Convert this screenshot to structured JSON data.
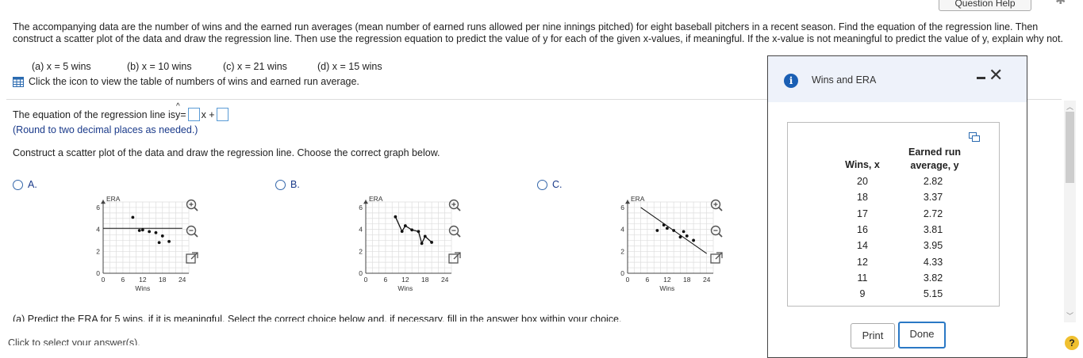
{
  "header": {
    "help_button_label": "Question Help",
    "settings_icon": "gear-icon"
  },
  "problem": {
    "text": "The accompanying data are the number of wins and the earned run averages (mean number of earned runs allowed per nine innings pitched) for eight baseball pitchers in a recent season. Find the equation of the regression line. Then construct a scatter plot of the data and draw the regression line. Then use the regression equation to predict the value of y for each of the given x-values, if meaningful. If the x-value is not meaningful to predict the value of y, explain why not.",
    "parts": [
      "(a) x = 5 wins",
      "(b) x = 10 wins",
      "(c) x = 21 wins",
      "(d) x = 15 wins"
    ],
    "table_link": "Click the icon to view the table of numbers of wins and earned run average."
  },
  "regression": {
    "prefix": "The equation of the regression line is ",
    "yhat": "y",
    "equals": " = ",
    "xplus": "x +",
    "hint": "(Round to two decimal places as needed.)"
  },
  "scatter_prompt": "Construct a scatter plot of the data and draw the regression line. Choose the correct graph below.",
  "options": [
    {
      "label": "A.",
      "ylabel": "ERA",
      "xlabel": "Wins",
      "yticks": [
        "6",
        "4",
        "2",
        "0"
      ],
      "xticks": [
        "0",
        "6",
        "12",
        "18",
        "24"
      ]
    },
    {
      "label": "B.",
      "ylabel": "ERA",
      "xlabel": "Wins",
      "yticks": [
        "6",
        "4",
        "2",
        "0"
      ],
      "xticks": [
        "0",
        "6",
        "12",
        "18",
        "24"
      ]
    },
    {
      "label": "C.",
      "ylabel": "ERA",
      "xlabel": "Wins",
      "yticks": [
        "6",
        "4",
        "2",
        "0"
      ],
      "xticks": [
        "0",
        "6",
        "12",
        "18",
        "24"
      ]
    }
  ],
  "part_a_prompt": "(a) Predict the ERA for 5 wins, if it is meaningful. Select the correct choice below and, if necessary, fill in the answer box within your choice.",
  "answer_prompt": "Click to select your answer(s).",
  "help_icon": "?",
  "modal": {
    "title": "Wins and ERA",
    "col1": "Wins, x",
    "col2_line1": "Earned run",
    "col2_line2": "average, y",
    "rows": [
      {
        "x": "20",
        "y": "2.82"
      },
      {
        "x": "18",
        "y": "3.37"
      },
      {
        "x": "17",
        "y": "2.72"
      },
      {
        "x": "16",
        "y": "3.81"
      },
      {
        "x": "14",
        "y": "3.95"
      },
      {
        "x": "12",
        "y": "4.33"
      },
      {
        "x": "11",
        "y": "3.82"
      },
      {
        "x": "9",
        "y": "5.15"
      }
    ],
    "print_label": "Print",
    "done_label": "Done"
  }
}
